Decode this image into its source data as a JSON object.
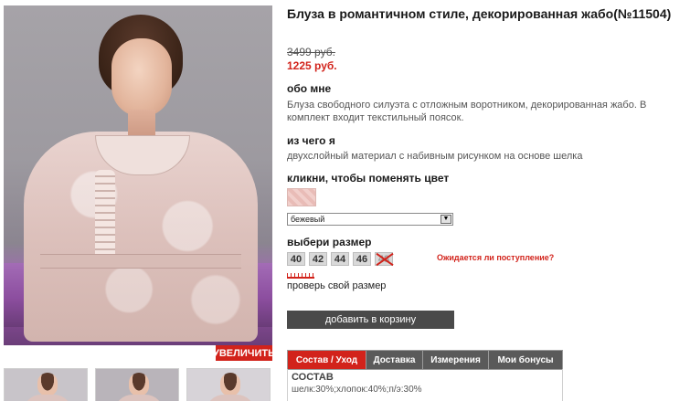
{
  "product": {
    "title": "Блуза в романтичном стиле, декорированная жабо(№11504)",
    "old_price": "3499 руб.",
    "new_price": "1225 руб.",
    "zoom_label": "УВЕЛИЧИТЬ"
  },
  "about": {
    "heading": "обо мне",
    "text": "Блуза свободного силуэта с отложным воротником, декорированная жабо. В комплект входит текстильный поясок."
  },
  "material": {
    "heading": "из чего я",
    "text": "двухслойный материал с набивным рисунком на основе шелка"
  },
  "color": {
    "heading": "кликни, чтобы поменять цвет",
    "selected": "бежевый",
    "swatch_color": "#efc8c3"
  },
  "size": {
    "heading": "выбери размер",
    "options": [
      "40",
      "42",
      "44",
      "46",
      "48"
    ],
    "unavailable_option": "48",
    "awaiting_link": "Ожидается ли поступление?",
    "check_size_link": "проверь свой размер"
  },
  "cart": {
    "add_label": "добавить в корзину"
  },
  "tabs": {
    "items": [
      "Состав / Уход",
      "Доставка",
      "Измерения",
      "Мои бонусы"
    ],
    "active": "Состав / Уход",
    "panel_title": "СОСТАВ",
    "panel_text": "шелк:30%;хлопок:40%;п/э:30%"
  },
  "colors": {
    "accent": "#d2231b",
    "button_dark": "#4a4a4a",
    "tab_inactive": "#5a5a5a"
  }
}
